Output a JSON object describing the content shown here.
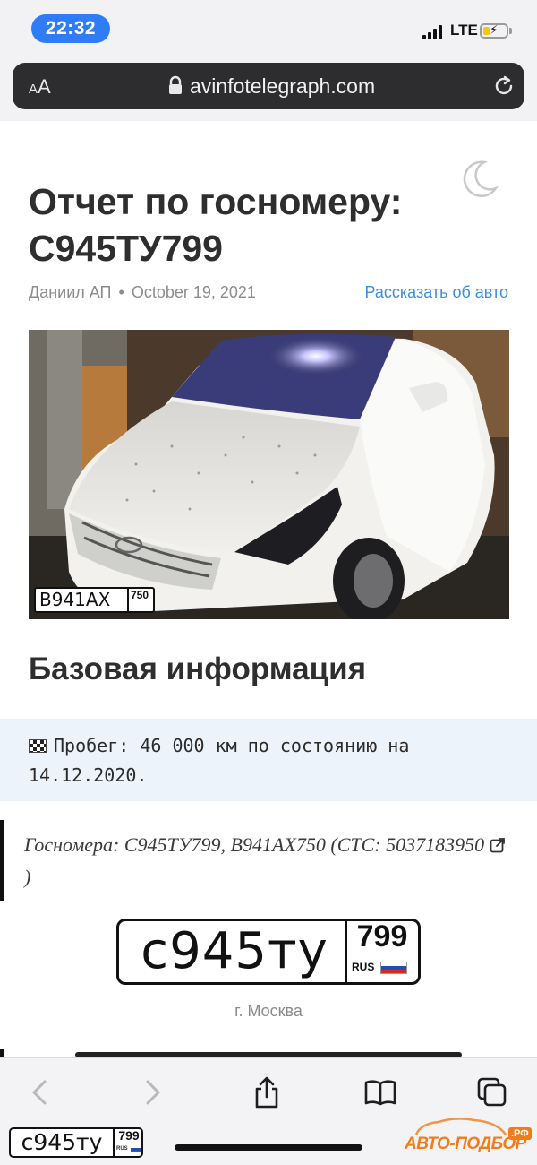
{
  "status_bar": {
    "time": "22:32",
    "network": "LTE",
    "battery_level": 0.3,
    "battery_color": "#f5c518"
  },
  "browser": {
    "text_size_label": "AA",
    "url": "avinfotelegraph.com",
    "lock_icon": "lock-icon",
    "reload_icon": "reload-icon"
  },
  "article": {
    "theme_toggle_icon": "moon-icon",
    "title": "Отчет по госномеру: С945ТУ799",
    "author": "Даниил АП",
    "date_separator": "•",
    "date": "October 19, 2021",
    "tell_link": "Рассказать об авто",
    "photo": {
      "plate_number": "В941АХ",
      "plate_region": "750"
    },
    "section_title": "Базовая информация",
    "mileage_text": "Пробег: 46 000 км по состоянию на 14.12.2020.",
    "mileage_icon": "checkered-flag-icon",
    "plates_text": "Госномера: С945ТУ799, В941АХ750 (СТС: 5037183950",
    "plates_text_end": ")",
    "external_link_icon": "external-link-icon",
    "plate": {
      "number": "с945ту",
      "region": "799",
      "country": "RUS"
    },
    "city": "г. Москва"
  },
  "toolbar": {
    "back_icon": "back-icon",
    "forward_icon": "forward-icon",
    "share_icon": "share-icon",
    "bookmarks_icon": "bookmarks-icon",
    "tabs_icon": "tabs-icon"
  },
  "overlay": {
    "plate_number": "с945ту",
    "plate_region": "799",
    "plate_country": "RUS",
    "watermark_text": "АВТО-ПОДБОР",
    "watermark_suffix": ".РФ",
    "watermark_color": "#f07c1a"
  },
  "colors": {
    "accent_blue": "#2f7cf6",
    "link_blue": "#3c8fe0",
    "code_bg": "#edf3fa"
  }
}
